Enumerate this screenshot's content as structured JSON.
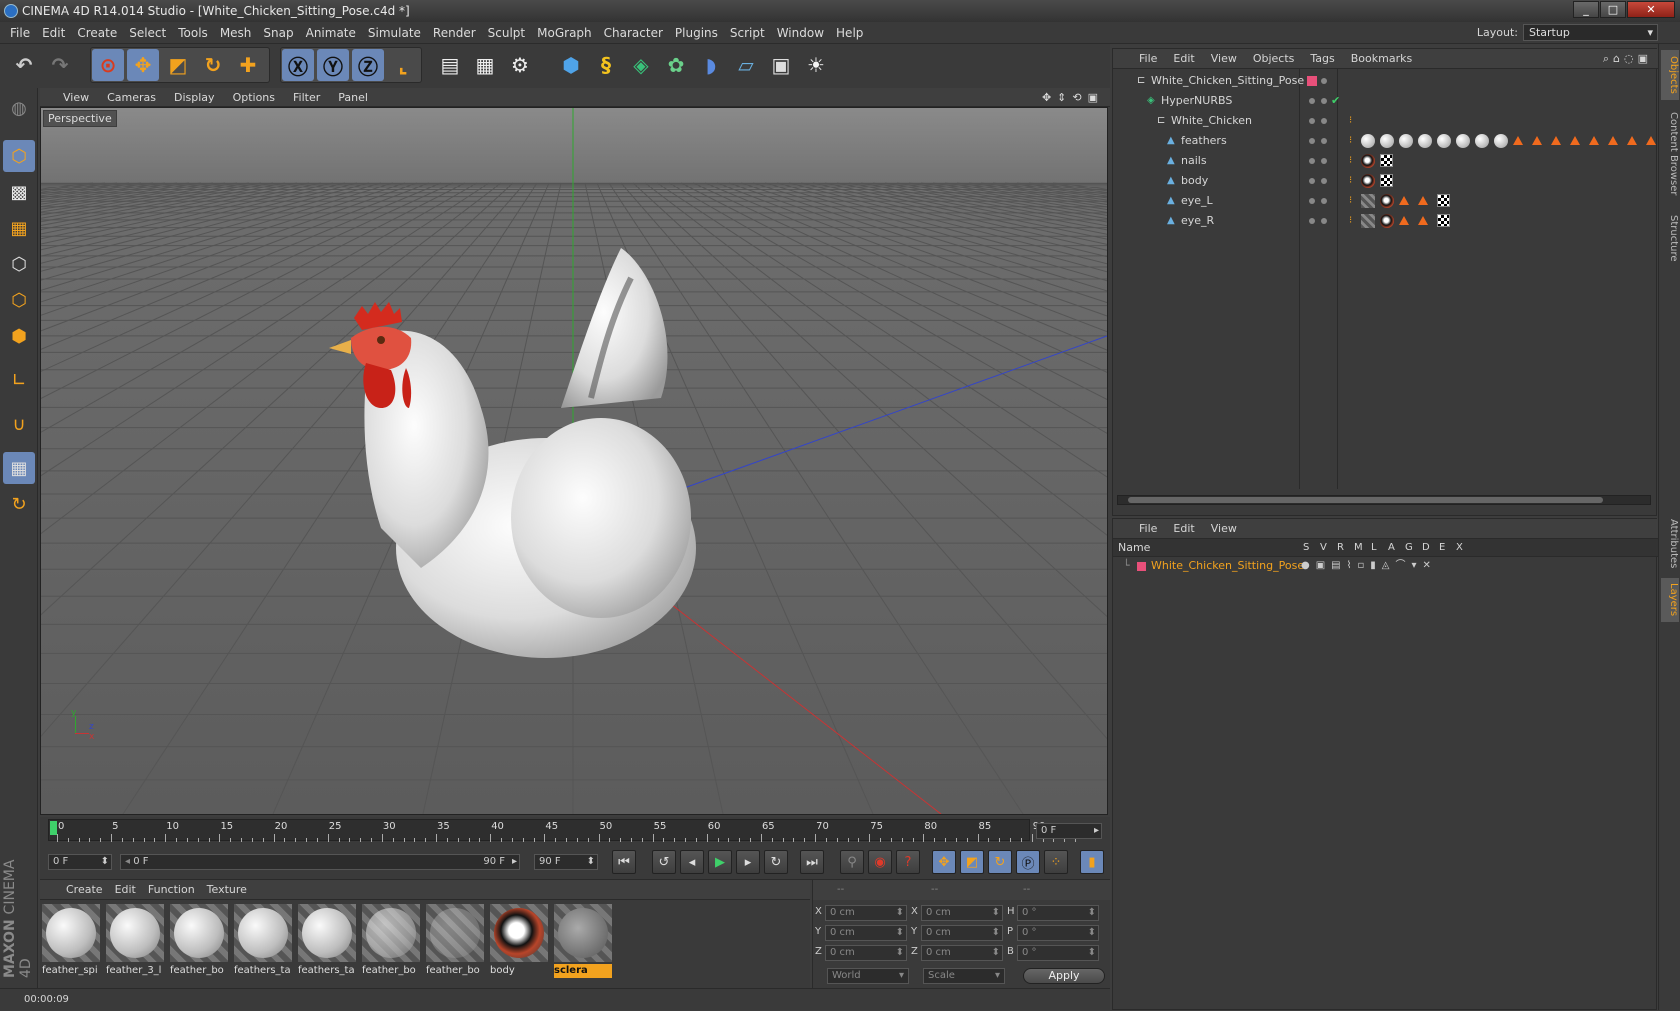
{
  "window": {
    "title": "CINEMA 4D R14.014 Studio - [White_Chicken_Sitting_Pose.c4d *]",
    "min": "_",
    "max": "□",
    "close": "✕"
  },
  "menu": [
    "File",
    "Edit",
    "Create",
    "Select",
    "Tools",
    "Mesh",
    "Snap",
    "Animate",
    "Simulate",
    "Render",
    "Sculpt",
    "MoGraph",
    "Character",
    "Plugins",
    "Script",
    "Window",
    "Help"
  ],
  "layout": {
    "label": "Layout:",
    "value": "Startup"
  },
  "viewport": {
    "menu": [
      "View",
      "Cameras",
      "Display",
      "Options",
      "Filter",
      "Panel"
    ],
    "label": "Perspective",
    "axes": {
      "y": "y",
      "z": "z",
      "x": "x"
    }
  },
  "timeline": {
    "ticks": [
      "0",
      "5",
      "10",
      "15",
      "20",
      "25",
      "30",
      "35",
      "40",
      "45",
      "50",
      "55",
      "60",
      "65",
      "70",
      "75",
      "80",
      "85",
      "90"
    ],
    "current": "0 F"
  },
  "transport": {
    "start": "0 F",
    "range_start": "0 F",
    "range_end": "90 F",
    "end": "90 F"
  },
  "materials": {
    "menu": [
      "Create",
      "Edit",
      "Function",
      "Texture"
    ],
    "items": [
      {
        "name": "feather_spi"
      },
      {
        "name": "feather_3_l"
      },
      {
        "name": "feather_bo"
      },
      {
        "name": "feathers_ta"
      },
      {
        "name": "feathers_ta"
      },
      {
        "name": "feather_bo"
      },
      {
        "name": "feather_bo"
      },
      {
        "name": "body"
      },
      {
        "name": "sclera"
      }
    ]
  },
  "coords": {
    "headers": [
      "--",
      "--",
      "--"
    ],
    "rows": [
      {
        "a": "X",
        "av": "0 cm",
        "b": "X",
        "bv": "0 cm",
        "c": "H",
        "cv": "0 °"
      },
      {
        "a": "Y",
        "av": "0 cm",
        "b": "Y",
        "bv": "0 cm",
        "c": "P",
        "cv": "0 °"
      },
      {
        "a": "Z",
        "av": "0 cm",
        "b": "Z",
        "bv": "0 cm",
        "c": "B",
        "cv": "0 °"
      }
    ],
    "world": "World",
    "scale": "Scale",
    "apply": "Apply"
  },
  "status": "00:00:09",
  "objects": {
    "menu": [
      "File",
      "Edit",
      "View",
      "Objects",
      "Tags",
      "Bookmarks"
    ],
    "rows": [
      {
        "name": "White_Chicken_Sitting_Pose"
      },
      {
        "name": "HyperNURBS"
      },
      {
        "name": "White_Chicken"
      },
      {
        "name": "feathers"
      },
      {
        "name": "nails"
      },
      {
        "name": "body"
      },
      {
        "name": "eye_L"
      },
      {
        "name": "eye_R"
      }
    ]
  },
  "layers": {
    "menu": [
      "File",
      "Edit",
      "View"
    ],
    "header": {
      "name": "Name",
      "cols": [
        "S",
        "V",
        "R",
        "M",
        "L",
        "A",
        "G",
        "D",
        "E",
        "X"
      ]
    },
    "row": "White_Chicken_Sitting_Pose"
  },
  "sidetabs": [
    "Objects",
    "Content Browser",
    "Structure",
    "Attributes",
    "Layers"
  ],
  "brand": {
    "maxon": "MAXON",
    "product": "CINEMA 4D"
  }
}
